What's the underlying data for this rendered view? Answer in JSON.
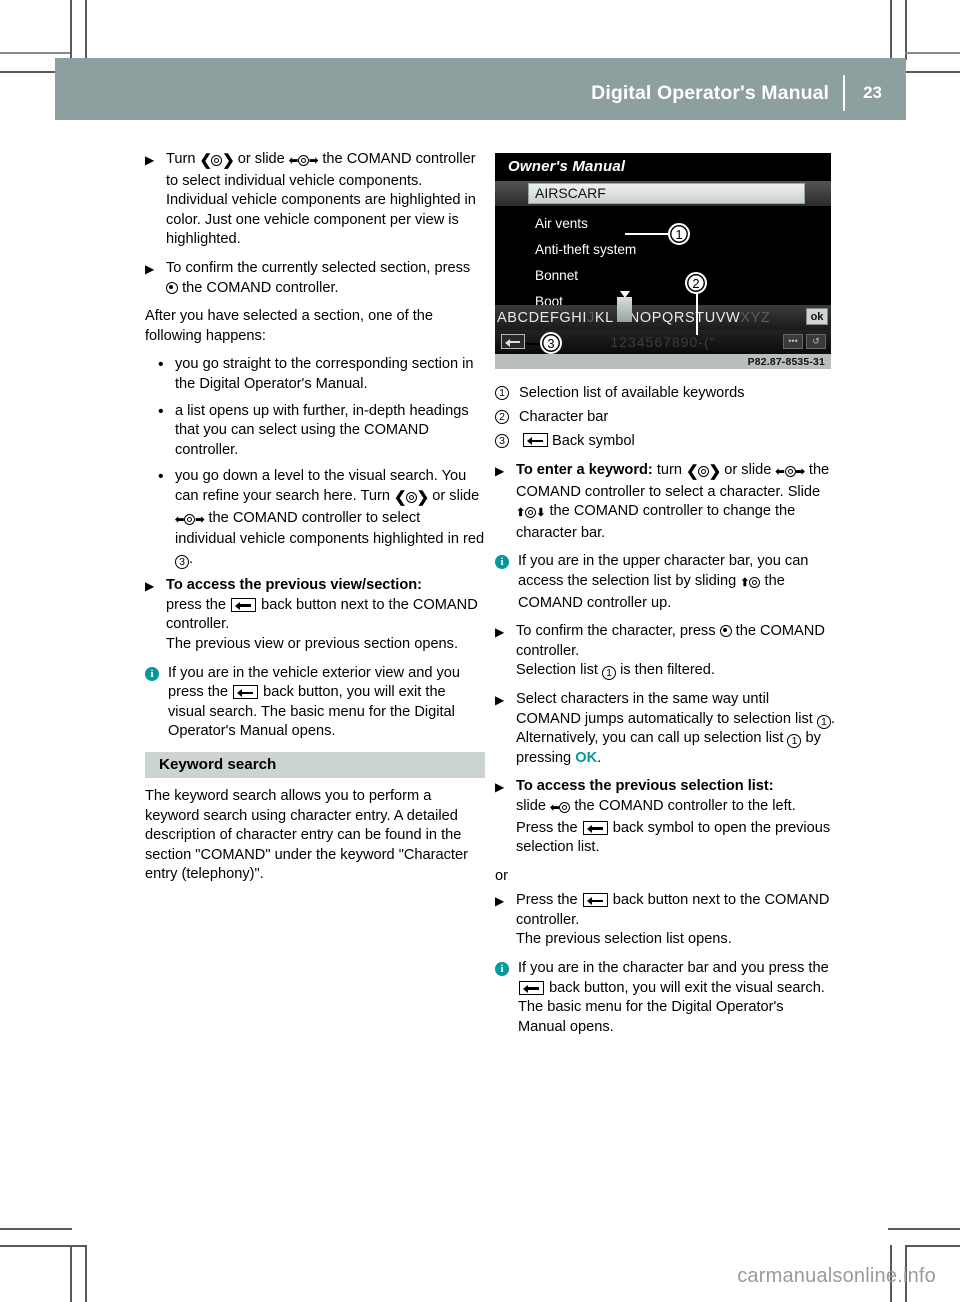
{
  "header": {
    "title": "Digital Operator's Manual",
    "page_number": "23"
  },
  "left_column": {
    "step1": {
      "pre": "Turn",
      "mid": "or slide",
      "post": "the COMAND controller to select individual vehicle components.",
      "follow": "Individual vehicle components are highlighted in color. Just one vehicle component per view is highlighted."
    },
    "step2": {
      "pre": "To confirm the currently selected section, press",
      "post": "the COMAND controller."
    },
    "after_para": "After you have selected a section, one of the following happens:",
    "bullets": [
      "you go straight to the corresponding section in the Digital Operator's Manual.",
      "a list opens up with further, in-depth headings that you can select using the COMAND controller.",
      "you go down a level to the visual search. You can refine your search here. Turn"
    ],
    "bullet3_mid": "or slide",
    "bullet3_post": "the COMAND controller to select individual vehicle components highlighted in red",
    "bullet3_num": "3",
    "bullet3_end": ".",
    "step3": {
      "bold": "To access the previous view/section:",
      "pre": "press the",
      "post": "back button next to the COMAND controller.",
      "follow": "The previous view or previous section opens."
    },
    "note1": {
      "pre": "If you are in the vehicle exterior view and you press the",
      "post": "back button, you will exit the visual search. The basic menu for the Digital Operator's Manual opens."
    },
    "section_heading": "Keyword search",
    "section_body": "The keyword search allows you to perform a keyword search using character entry. A detailed description of character entry can be found in the section \"COMAND\" under the keyword \"Character entry (telephony)\"."
  },
  "screenshot": {
    "title": "Owner's Manual",
    "selected_item": "AIRSCARF",
    "list_items": [
      "Air vents",
      "Anti-theft system",
      "Bonnet",
      "Boot"
    ],
    "char_bar_letters": "ABCDEFGHI",
    "char_bar_letters_mid": "KL",
    "char_bar_letters_mid2": "NOPQ",
    "char_bar_letters_end": "RSTUVW",
    "char_bar_dim": "XYZ",
    "char_bar_cursor": "M",
    "ok_label": "ok",
    "number_bar": "1234567890-(\"",
    "image_code": "P82.87-8535-31",
    "callouts": [
      "1",
      "2",
      "3"
    ]
  },
  "right_column": {
    "legend": [
      {
        "num": "1",
        "label": "Selection list of available keywords",
        "symbol": ""
      },
      {
        "num": "2",
        "label": "Character bar",
        "symbol": ""
      },
      {
        "num": "3",
        "label": "Back symbol",
        "symbol": "back-symbol"
      }
    ],
    "step1": {
      "bold": "To enter a keyword:",
      "pre": "turn",
      "mid": "or slide",
      "post": "the COMAND controller to select a character. Slide",
      "post2": "the COMAND controller to change the character bar."
    },
    "note1": {
      "pre": "If you are in the upper character bar, you can access the selection list by sliding",
      "post": "the COMAND controller up."
    },
    "step2": {
      "pre": "To confirm the character, press",
      "post": "the COMAND controller.",
      "follow_pre": "Selection list",
      "follow_num": "1",
      "follow_post": "is then filtered."
    },
    "step3": {
      "pre": "Select characters in the same way until COMAND jumps automatically to selection list",
      "num": "1",
      "post": ".",
      "alt_pre": "Alternatively, you can call up selection list",
      "alt_num": "1",
      "alt_mid": "by pressing",
      "alt_ok": "OK",
      "alt_end": "."
    },
    "step4": {
      "bold": "To access the previous selection list:",
      "pre": "slide",
      "post": "the COMAND controller to the left.",
      "follow_pre": "Press the",
      "follow_post": "back symbol to open the previous selection list."
    },
    "or_label": "or",
    "step5": {
      "pre": "Press the",
      "post": "back button next to the COMAND controller.",
      "follow": "The previous selection list opens."
    },
    "note2": {
      "pre": "If you are in the character bar and you press the",
      "post": "back button, you will exit the visual search. The basic menu for the Digital Operator's Manual opens."
    }
  },
  "watermark": "carmanualsonline.info",
  "colors": {
    "header_bg": "#8d9f9e",
    "section_bg": "#ccd4d2",
    "accent_teal": "#00999c",
    "watermark": "#9a9a9a"
  }
}
